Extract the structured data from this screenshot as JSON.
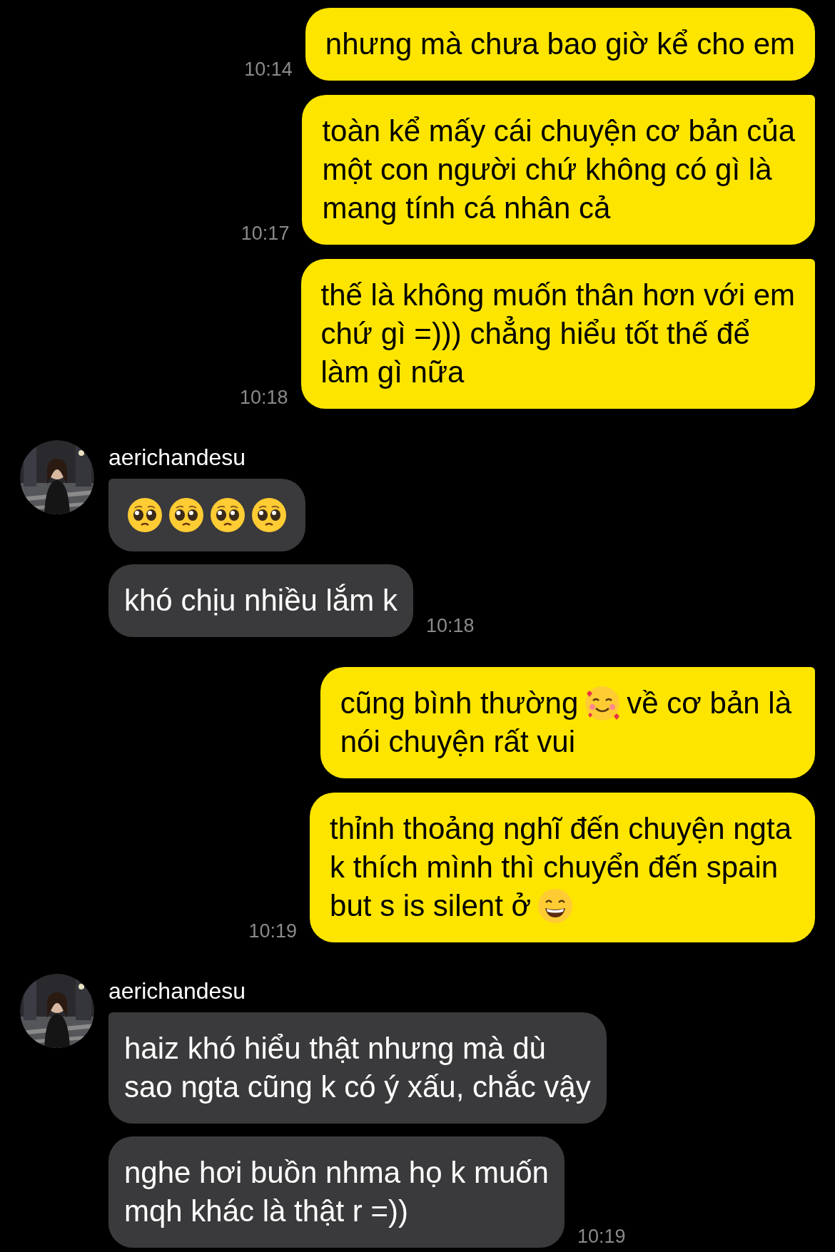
{
  "conversation": [
    {
      "kind": "sent",
      "messages": [
        {
          "lines": [
            [
              {
                "kind": "text",
                "text": "nhưng mà chưa bao giờ kể cho em"
              }
            ]
          ],
          "time": "10:14",
          "tail": false
        },
        {
          "lines": [
            [
              {
                "kind": "text",
                "text": "toàn kể mấy cái chuyện cơ bản của"
              }
            ],
            [
              {
                "kind": "text",
                "text": "một con người chứ không có gì là"
              }
            ],
            [
              {
                "kind": "text",
                "text": "mang tính cá nhân cả"
              }
            ]
          ],
          "time": "10:17",
          "tail": true
        },
        {
          "lines": [
            [
              {
                "kind": "text",
                "text": "thế là không muốn thân hơn với em"
              }
            ],
            [
              {
                "kind": "text",
                "text": "chứ gì =))) chẳng hiểu tốt thế để"
              }
            ],
            [
              {
                "kind": "text",
                "text": "làm gì nữa"
              }
            ]
          ],
          "time": "10:18",
          "tail": true
        }
      ]
    },
    {
      "kind": "received",
      "sender": "aerichandesu",
      "messages": [
        {
          "lines": [
            [
              {
                "kind": "pleading"
              },
              {
                "kind": "pleading"
              },
              {
                "kind": "pleading"
              },
              {
                "kind": "pleading"
              }
            ]
          ],
          "tail": true
        },
        {
          "lines": [
            [
              {
                "kind": "text",
                "text": "khó chịu nhiều lắm k"
              }
            ]
          ],
          "time": "10:18",
          "tail": false
        }
      ]
    },
    {
      "kind": "sent",
      "messages": [
        {
          "lines": [
            [
              {
                "kind": "text",
                "text": "cũng bình thường"
              },
              {
                "kind": "hearts"
              },
              {
                "kind": "text",
                "text": "về cơ bản là"
              }
            ],
            [
              {
                "kind": "text",
                "text": "nói chuyện rất vui"
              }
            ]
          ],
          "tail": true
        },
        {
          "lines": [
            [
              {
                "kind": "text",
                "text": "thỉnh thoảng nghĩ đến chuyện ngta"
              }
            ],
            [
              {
                "kind": "text",
                "text": "k thích mình thì chuyển đến spain"
              }
            ],
            [
              {
                "kind": "text",
                "text": "but s is silent ở"
              },
              {
                "kind": "grin"
              }
            ]
          ],
          "time": "10:19",
          "tail": false
        }
      ]
    },
    {
      "kind": "received",
      "sender": "aerichandesu",
      "messages": [
        {
          "lines": [
            [
              {
                "kind": "text",
                "text": "haiz khó hiểu thật nhưng mà dù"
              }
            ],
            [
              {
                "kind": "text",
                "text": "sao ngta cũng k có ý xấu, chắc vậy"
              }
            ]
          ],
          "tail": true
        },
        {
          "lines": [
            [
              {
                "kind": "text",
                "text": "nghe hơi buồn nhma họ k muốn"
              }
            ],
            [
              {
                "kind": "text",
                "text": "mqh khác là thật r =))"
              }
            ]
          ],
          "time": "10:19",
          "tail": false
        }
      ]
    }
  ]
}
